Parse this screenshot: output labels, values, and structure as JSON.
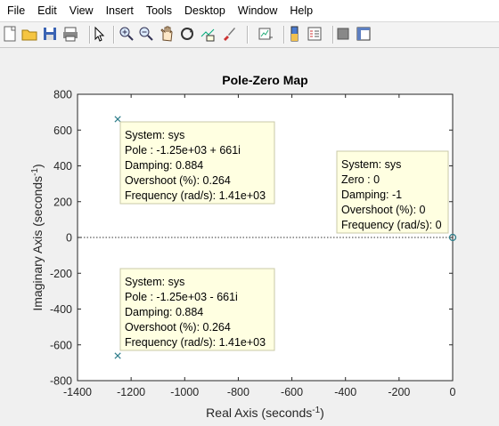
{
  "menu": [
    "File",
    "Edit",
    "View",
    "Insert",
    "Tools",
    "Desktop",
    "Window",
    "Help"
  ],
  "toolbar": {
    "icons": [
      "new-figure-icon",
      "open-file-icon",
      "save-icon",
      "print-icon",
      "pointer-icon",
      "zoom-in-icon",
      "zoom-out-icon",
      "pan-icon",
      "rotate-3d-icon",
      "data-cursor-icon",
      "brush-icon",
      "link-plot-icon",
      "colorbar-icon",
      "legend-icon",
      "hide-plot-tools-icon",
      "show-plot-tools-icon"
    ]
  },
  "chart_data": {
    "type": "scatter",
    "title": "Pole-Zero Map",
    "xlabel": "Real Axis (seconds",
    "xlabel_sup": "-1",
    "xlabel_end": ")",
    "ylabel": "Imaginary Axis (seconds",
    "ylabel_sup": "-1",
    "ylabel_end": ")",
    "xlim": [
      -1400,
      0
    ],
    "ylim": [
      -800,
      800
    ],
    "xticks": [
      -1400,
      -1200,
      -1000,
      -800,
      -600,
      -400,
      -200,
      0
    ],
    "yticks": [
      800,
      600,
      400,
      200,
      0,
      -200,
      -400,
      -600,
      -800
    ],
    "grid": false,
    "poles": [
      {
        "x": -1250,
        "y": 661
      },
      {
        "x": -1250,
        "y": -661
      }
    ],
    "zeros": [
      {
        "x": 0,
        "y": 0
      }
    ],
    "datatips": [
      {
        "lines": [
          "System: sys",
          "Pole : -1.25e+03 + 661i",
          "Damping: 0.884",
          "Overshoot (%): 0.264",
          "Frequency (rad/s): 1.41e+03"
        ]
      },
      {
        "lines": [
          "System: sys",
          "Zero : 0",
          "Damping: -1",
          "Overshoot (%): 0",
          "Frequency (rad/s): 0"
        ]
      },
      {
        "lines": [
          "System: sys",
          "Pole : -1.25e+03 - 661i",
          "Damping: 0.884",
          "Overshoot (%): 0.264",
          "Frequency (rad/s): 1.41e+03"
        ]
      }
    ],
    "colors": {
      "marker": "#2e7d8a",
      "tip_bg": "#ffffe1",
      "tip_border": "#c9c9a8"
    }
  }
}
